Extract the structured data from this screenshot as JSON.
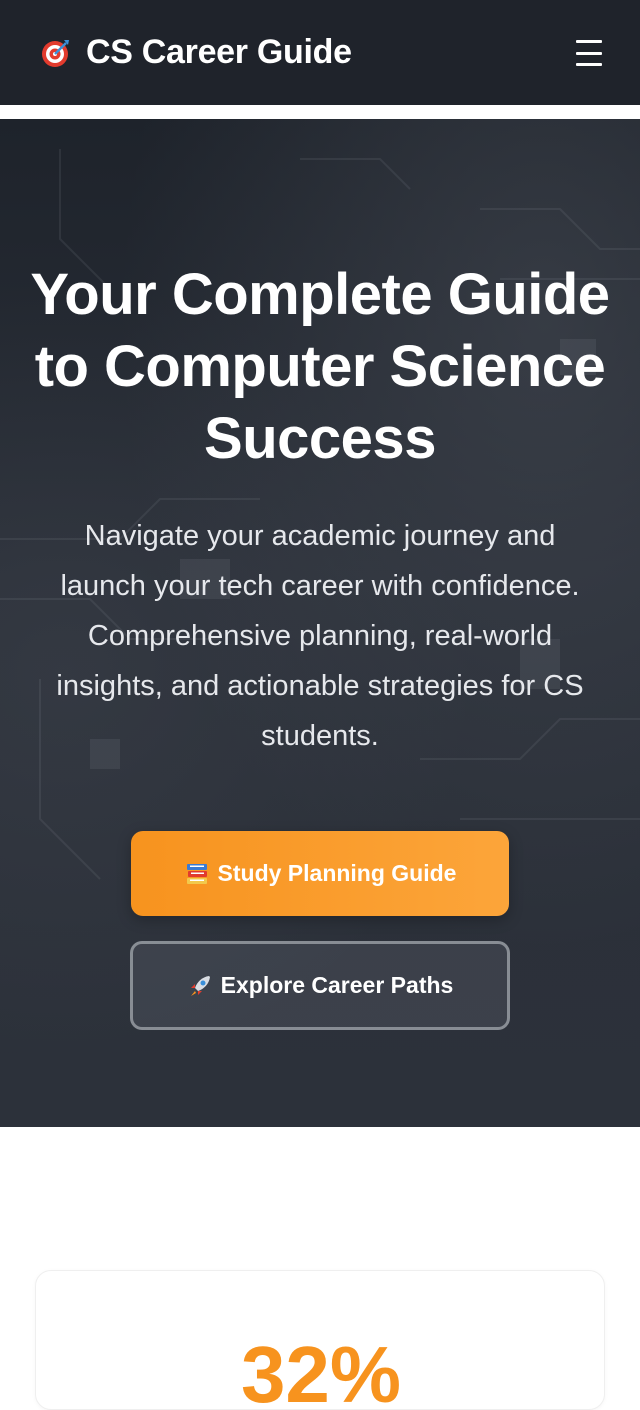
{
  "header": {
    "brand": "CS Career Guide",
    "logo_icon": "target-icon",
    "menu_icon": "hamburger-menu-icon",
    "background": "#1f232b"
  },
  "hero": {
    "title": "Your Complete Guide to Computer Science Success",
    "subtitle": "Navigate your academic journey and launch your tech career with confidence. Comprehensive planning, real-world insights, and actionable strategies for CS students.",
    "primary_button": {
      "label": "Study Planning Guide",
      "icon": "books-icon",
      "color": "#f7931e"
    },
    "secondary_button": {
      "label": "Explore Career Paths",
      "icon": "rocket-icon"
    }
  },
  "stats": {
    "first_value": "32%",
    "accent": "#f7931e"
  }
}
